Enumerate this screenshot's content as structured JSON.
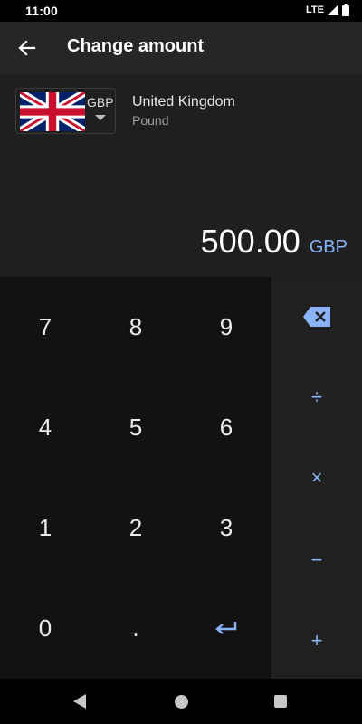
{
  "status_bar": {
    "time": "11:00",
    "network": "LTE",
    "icons": [
      "signal-icon",
      "battery-icon"
    ]
  },
  "app_bar": {
    "title": "Change amount",
    "back_icon": "arrow-left-icon"
  },
  "currency": {
    "code": "GBP",
    "country": "United Kingdom",
    "name": "Pound",
    "flag_icon": "uk-flag-icon"
  },
  "amount": {
    "value": "500.00",
    "code": "GBP"
  },
  "keypad": {
    "keys": [
      "7",
      "8",
      "9",
      "4",
      "5",
      "6",
      "1",
      "2",
      "3",
      "0",
      ".",
      "↵"
    ]
  },
  "operators": {
    "backspace_icon": "backspace-icon",
    "divide": "÷",
    "multiply": "×",
    "minus": "−",
    "plus": "+"
  },
  "colors": {
    "accent": "#8ab4f8",
    "header_bg": "#1f1f1f",
    "keypad_bg": "#121212",
    "ops_bg": "#202020"
  },
  "nav_bar": {
    "icons": [
      "nav-back-icon",
      "nav-home-icon",
      "nav-recents-icon"
    ]
  }
}
